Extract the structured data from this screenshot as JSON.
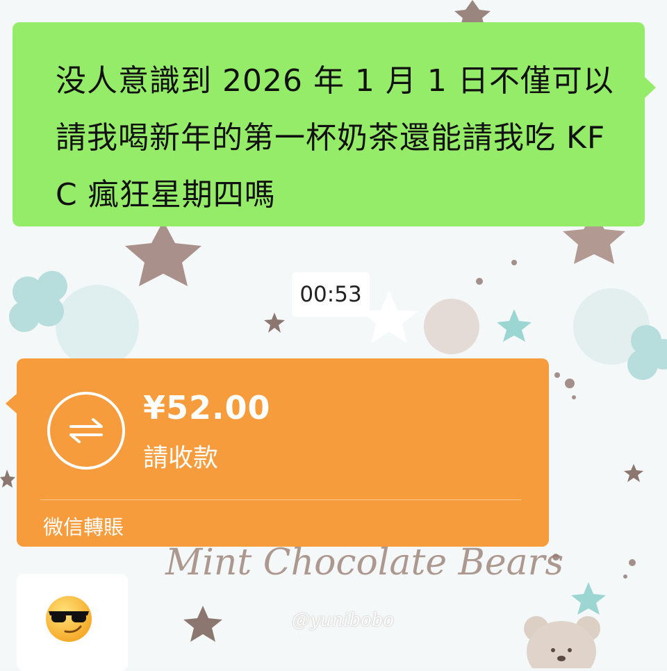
{
  "chat": {
    "outgoing_message": "没人意識到 2026 年 1 月 1 日不僅可以請我喝新年的第一杯奶茶還能請我吃 KFC 瘋狂星期四嗎",
    "timestamp": "00:53",
    "transfer": {
      "amount": "¥52.00",
      "status": "請收款",
      "source": "微信轉賬",
      "icon": "transfer-arrows-icon"
    },
    "incoming_emoji": "sunglasses-smirk-emoji"
  },
  "wallpaper": {
    "title": "Mint Chocolate Bears",
    "handle": "@yunibobo"
  },
  "colors": {
    "outgoing_bubble": "#95ec69",
    "transfer_bubble": "#f79c3c",
    "incoming_bubble": "#ffffff"
  }
}
